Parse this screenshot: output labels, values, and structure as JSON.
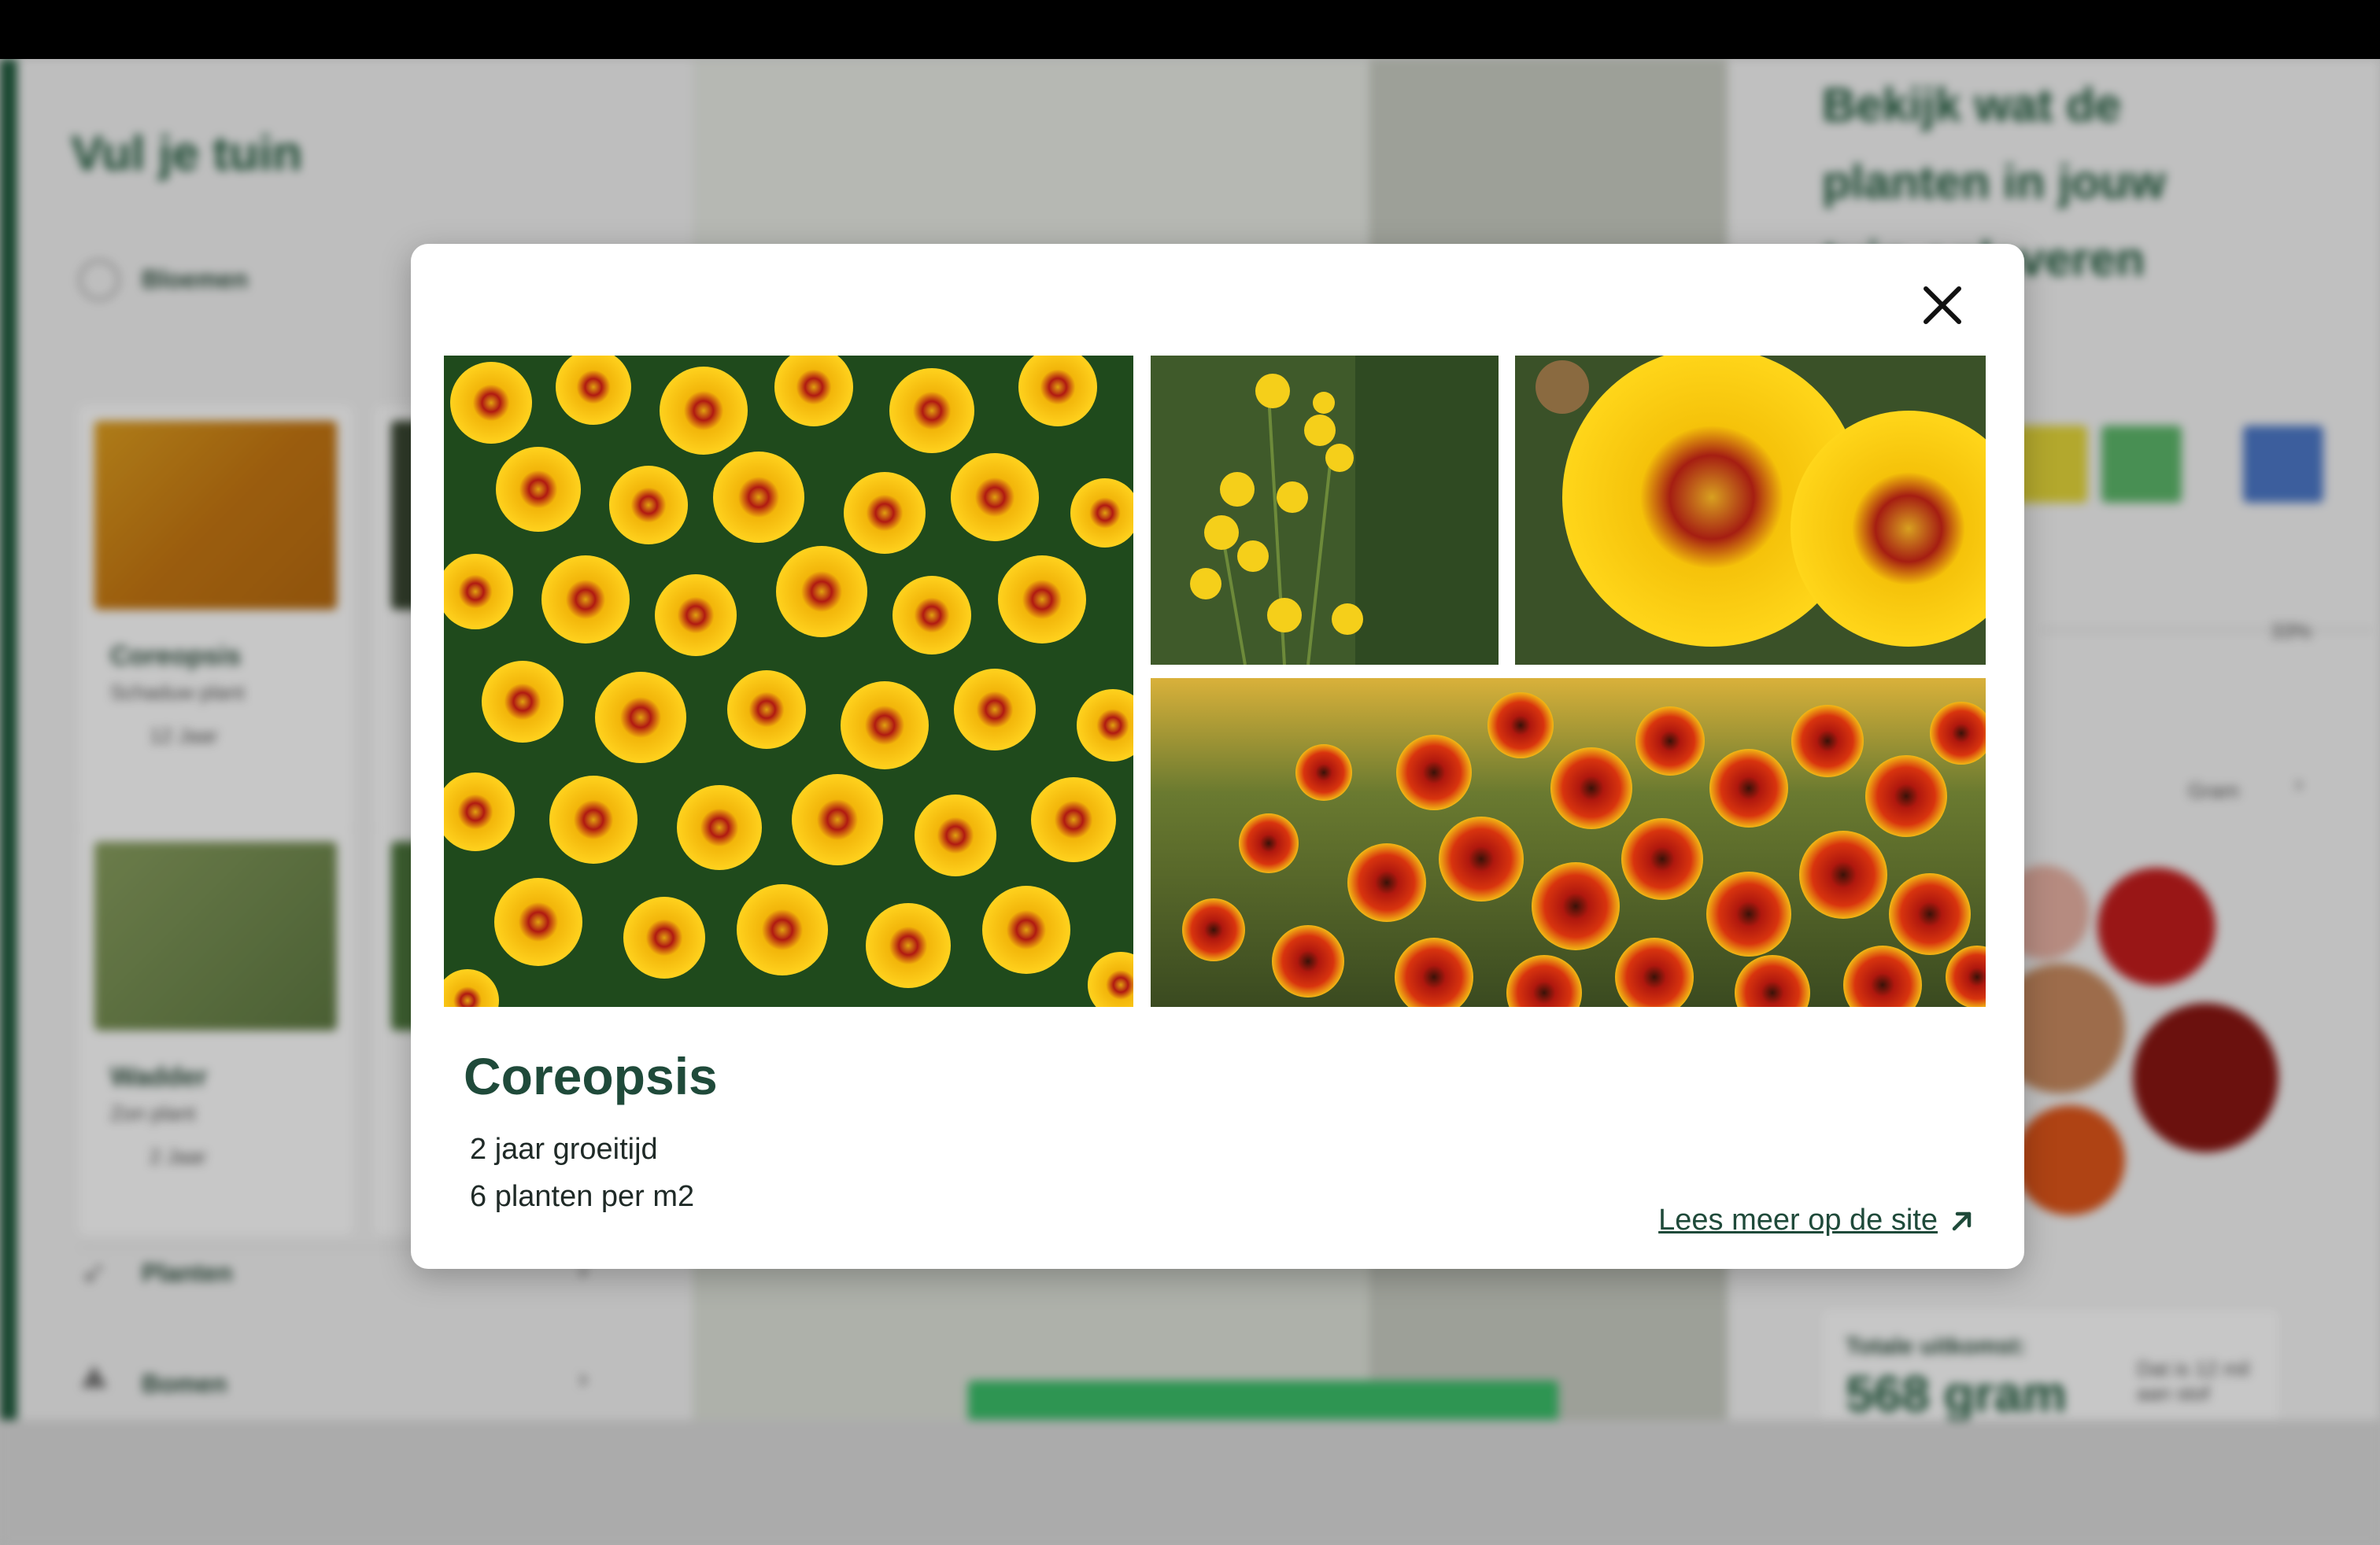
{
  "background": {
    "left_title": "Vul je tuin",
    "categories": [
      {
        "label": "Bloemen",
        "icon": "flower-icon"
      },
      {
        "label": "Planten",
        "icon": "leaf-icon"
      },
      {
        "label": "Bomen",
        "icon": "tree-icon"
      }
    ],
    "cards": [
      {
        "name": "Coreopsis",
        "sub": "Schaduw plant",
        "years": "12 Jaar"
      },
      {
        "name": "Wadder",
        "sub": "Zon plant",
        "years": "2 Jaar"
      }
    ],
    "right_title": "Bekijk wat de planten in jouw tuin opleveren",
    "percent": "33%",
    "gram_label": "Gram",
    "total_label": "Totale uitkomst:",
    "total_value": "568 gram",
    "total_note": "Dat is 12 mil aan stof"
  },
  "modal": {
    "title": "Coreopsis",
    "growth_time": "2 jaar groeitijd",
    "plants_per_m2": "6 planten per m2",
    "read_more": "Lees meer op de site",
    "close_icon": "close-icon",
    "link_icon": "arrow-up-right-icon",
    "accent_color": "#1f4a3a"
  }
}
